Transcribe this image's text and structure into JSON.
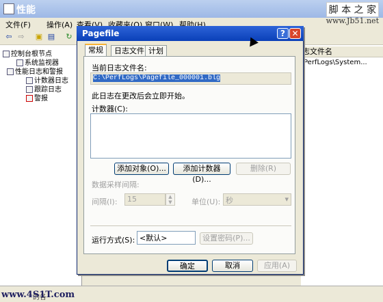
{
  "main_window": {
    "title": "性能",
    "menus": [
      "文件(F)",
      "操作(A)",
      "查看(V)",
      "收藏夹(O)",
      "窗口(W)",
      "帮助(H)"
    ],
    "tree": [
      "控制台根节点",
      "系统监视器",
      "性能日志和警报",
      "计数器日志",
      "跟踪日志",
      "警报"
    ],
    "column_header": "志文件名",
    "row_text": "PerfLogs\\System...",
    "status_text": "的各"
  },
  "watermarks": {
    "top": "脚 本 之 家",
    "url": "www.Jb51.net",
    "bottom": "www.4S1T.com"
  },
  "dialog": {
    "title": "Pagefile",
    "tabs": [
      "常规",
      "日志文件",
      "计划"
    ],
    "current_log_label": "当前日志文件名:",
    "current_log_value": "C:\\PerfLogs\\Pagefile_000001.blg",
    "note": "此日志在更改后会立即开始。",
    "counters_label": "计数器(C):",
    "add_objects": "添加对象(O)...",
    "add_counters": "添加计数器(D)...",
    "remove": "删除(R)",
    "sample_interval_label": "数据采样间隔:",
    "interval_label": "间隔(I):",
    "interval_value": "15",
    "units_label": "单位(U):",
    "units_value": "秒",
    "run_as_label": "运行方式(S):",
    "run_as_value": "<默认>",
    "set_password": "设置密码(P)...",
    "ok": "确定",
    "cancel": "取消",
    "apply": "应用(A)"
  }
}
